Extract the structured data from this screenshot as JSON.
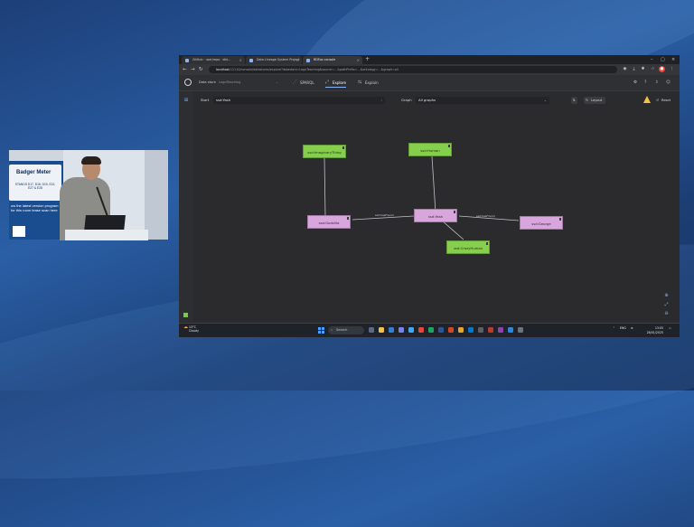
{
  "poster": {
    "brand": "Badger Meter",
    "booth": "STANDS D17, D18, D19, E22, E27 & E28",
    "message": "ow the latest version program for this room lease scan here"
  },
  "browser": {
    "tabs": [
      {
        "label": "GitHub · user/repo · dbt..."
      },
      {
        "label": "Data Lineage System Project"
      },
      {
        "label": "RDFox console"
      }
    ],
    "url_host": "localhost",
    "url_rest": ":12110/console/datastores/explore?datastore=LegoTeaching&source=…&pathPrefix=…&ontology=…&graph=all"
  },
  "app": {
    "datastore_label": "Data store",
    "datastore_value": "LegoTeaching",
    "nav": {
      "sparql": "SPARQL",
      "explore": "Explore",
      "explain": "Explain"
    }
  },
  "toolbar": {
    "start_label": "Start",
    "start_value": "ssd:Yash",
    "graph_label": "Graph",
    "graph_value": "All graphs",
    "layout_label": "Layout",
    "reset_label": "Reset"
  },
  "graph": {
    "nodes": {
      "imaginary": "ssd:ImaginaryThing",
      "human": "ssd:Human",
      "yash": "ssd:Yash",
      "godzilla": "ssd:Godzilla",
      "george": "ssd:George",
      "crazyhuman": "ssd:CrazyHuman"
    },
    "edges": {
      "hasfriend_left": "ssd:hasFriend",
      "hasfriend_right": "ssd:hasFriend",
      "type": "rdf:type"
    }
  },
  "taskbar": {
    "temp": "13°C",
    "weather": "Cloudy",
    "search": "Search",
    "lang": "ENG",
    "time": "13:05",
    "date": "28/01/2025"
  },
  "colors": {
    "node_class": "#86cf4d",
    "node_individual": "#d8a5dc",
    "accent": "#8ab4f8"
  }
}
